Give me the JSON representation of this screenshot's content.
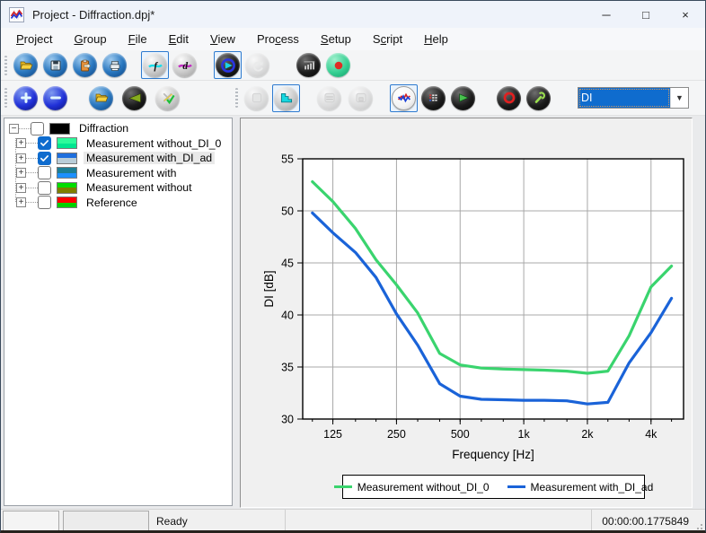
{
  "window": {
    "title": "Project - Diffraction.dpj*",
    "controls": [
      {
        "name": "minimize",
        "glyph": "─"
      },
      {
        "name": "maximize",
        "glyph": "□"
      },
      {
        "name": "close",
        "glyph": "×"
      }
    ]
  },
  "menu": {
    "items": [
      {
        "label": "Project",
        "mnemonic": 0
      },
      {
        "label": "Group",
        "mnemonic": 0
      },
      {
        "label": "File",
        "mnemonic": 0
      },
      {
        "label": "Edit",
        "mnemonic": 0
      },
      {
        "label": "View",
        "mnemonic": 0
      },
      {
        "label": "Process",
        "mnemonic": 3
      },
      {
        "label": "Setup",
        "mnemonic": 0
      },
      {
        "label": "Script",
        "mnemonic": 1
      },
      {
        "label": "Help",
        "mnemonic": 0
      }
    ]
  },
  "toolbar_main": {
    "buttons": [
      {
        "name": "open-button",
        "glyph": "folder-open",
        "base": "blue"
      },
      {
        "name": "save-button",
        "glyph": "floppy",
        "base": "blue"
      },
      {
        "name": "export-button",
        "glyph": "clipboard-arrow",
        "base": "blue"
      },
      {
        "name": "print-button",
        "glyph": "printer",
        "base": "blue"
      },
      {
        "name": "frequency-domain-button",
        "glyph": "f-wave",
        "base": "silver",
        "selected": true,
        "ml": 12
      },
      {
        "name": "data-domain-button",
        "glyph": "d-wave",
        "base": "silver"
      },
      {
        "name": "run-process-button",
        "glyph": "arrow-right",
        "base": "black",
        "selected": true,
        "ml": 15
      },
      {
        "name": "repeat-process-button",
        "glyph": "redo",
        "base": "silver",
        "disabled": true
      },
      {
        "name": "level-meter-button",
        "glyph": "level-bars",
        "base": "black",
        "ml": 24
      },
      {
        "name": "record-button",
        "glyph": "record-dot",
        "base": "green"
      }
    ]
  },
  "toolbar_secondary": {
    "group1": [
      {
        "name": "zoom-in-button",
        "glyph": "plus",
        "base": "darkblue"
      },
      {
        "name": "zoom-out-button",
        "glyph": "minus",
        "base": "darkblue"
      },
      {
        "name": "open-group-button",
        "glyph": "folder-open",
        "base": "blue",
        "ml": 18
      },
      {
        "name": "wedge-button",
        "glyph": "wedge",
        "base": "black",
        "ml": 4
      },
      {
        "name": "edit-tools-button",
        "glyph": "tools-check",
        "base": "silver",
        "ml": 4
      }
    ],
    "group2": [
      {
        "name": "window-single-button",
        "glyph": "blank",
        "base": "silver",
        "disabled": true
      },
      {
        "name": "window-steps-button",
        "glyph": "steps",
        "base": "silver",
        "selected": true
      },
      {
        "name": "window-split-button",
        "glyph": "hlines",
        "base": "silver",
        "disabled": true,
        "ml": 15
      },
      {
        "name": "window-inset-button",
        "glyph": "sheet",
        "base": "silver",
        "disabled": true,
        "ml": 2
      },
      {
        "name": "curve-plot-button",
        "glyph": "curves",
        "base": "white",
        "selected": true,
        "ml": 15
      },
      {
        "name": "table-view-button",
        "glyph": "grid",
        "base": "black"
      },
      {
        "name": "play-button",
        "glyph": "play-wedge",
        "base": "black"
      },
      {
        "name": "target-button",
        "glyph": "red-ring",
        "base": "black",
        "ml": 18
      },
      {
        "name": "settings-button",
        "glyph": "wrench",
        "base": "black"
      }
    ],
    "combo": {
      "value": "DI"
    }
  },
  "tree": {
    "items": [
      {
        "label": "Diffraction",
        "level": 0,
        "expander": "minus",
        "checked": false,
        "swatch": [
          "#000000",
          "#000000"
        ]
      },
      {
        "label": "Measurement without_DI_0",
        "level": 1,
        "expander": "plus",
        "checked": true,
        "swatch": [
          "#2dfb9a",
          "#00e690"
        ]
      },
      {
        "label": "Measurement with_DI_ad",
        "level": 1,
        "expander": "plus",
        "checked": true,
        "swatch": [
          "#1e6fdd",
          "#b9cdd8"
        ],
        "selected": true
      },
      {
        "label": "Measurement with",
        "level": 1,
        "expander": "plus",
        "checked": false,
        "swatch": [
          "#1d7f96",
          "#1e90ff"
        ]
      },
      {
        "label": "Measurement without",
        "level": 1,
        "expander": "plus",
        "checked": false,
        "swatch": [
          "#00dd00",
          "#7f7f00"
        ]
      },
      {
        "label": "Reference",
        "level": 1,
        "expander": "plus",
        "checked": false,
        "swatch": [
          "#ff0000",
          "#00d200"
        ]
      }
    ]
  },
  "status": {
    "message": "Ready",
    "timer": "00:00:00.1775849"
  },
  "chart_data": {
    "type": "line",
    "title": "",
    "xlabel": "Frequency [Hz]",
    "ylabel": "DI [dB]",
    "xscale": "log",
    "xlim": [
      90,
      5700
    ],
    "ylim": [
      30,
      55
    ],
    "grid": true,
    "legend_position": "bottom",
    "grid_color": "#a8a8a8",
    "xticks": [
      {
        "v": 125,
        "label": "125"
      },
      {
        "v": 250,
        "label": "250"
      },
      {
        "v": 500,
        "label": "500"
      },
      {
        "v": 1000,
        "label": "1k"
      },
      {
        "v": 2000,
        "label": "2k"
      },
      {
        "v": 4000,
        "label": "4k"
      }
    ],
    "minor_xticks": [
      100,
      125,
      160,
      200,
      250,
      315,
      400,
      500,
      630,
      800,
      1000,
      1250,
      1600,
      2000,
      2500,
      3150,
      4000,
      5000
    ],
    "yticks": [
      30,
      35,
      40,
      45,
      50,
      55
    ],
    "frequencies": [
      100,
      125,
      160,
      200,
      250,
      315,
      400,
      500,
      630,
      800,
      1000,
      1250,
      1600,
      2000,
      2500,
      3150,
      4000,
      5000
    ],
    "series": [
      {
        "name": "Measurement without_DI_0",
        "color": "#3ad46e",
        "values": [
          52.8,
          50.9,
          48.3,
          45.3,
          42.9,
          40.2,
          36.3,
          35.2,
          34.9,
          34.8,
          34.75,
          34.7,
          34.6,
          34.4,
          34.6,
          38.0,
          42.7,
          44.7
        ]
      },
      {
        "name": "Measurement with_DI_ad",
        "color": "#1a63d8",
        "values": [
          49.8,
          47.9,
          46.0,
          43.6,
          40.1,
          37.1,
          33.4,
          32.2,
          31.9,
          31.85,
          31.8,
          31.8,
          31.75,
          31.45,
          31.6,
          35.4,
          38.3,
          41.6
        ]
      }
    ]
  }
}
